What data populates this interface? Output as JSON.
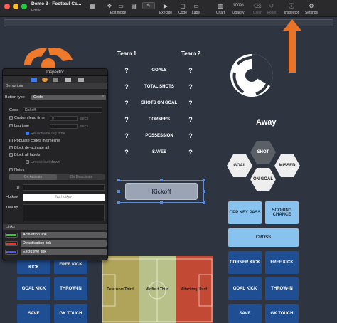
{
  "window": {
    "title": "Demo 3 - Football Co...",
    "subtitle": "Edited"
  },
  "toolbar": {
    "edit_mode_label": "Edit mode",
    "execute_label": "Execute",
    "code_label": "Code",
    "label_label": "Label",
    "chart_label": "Chart",
    "zoom_value": "100%",
    "opacity_label": "Opacity",
    "clear_label": "Clear",
    "reset_label": "Reset",
    "inspector_label": "Inspector",
    "settings_label": "Settings"
  },
  "scoreboard": {
    "team1": "Team 1",
    "team2": "Team 2",
    "placeholder": "?",
    "stats": [
      "GOALS",
      "TOTAL SHOTS",
      "SHOTS ON GOAL",
      "CORNERS",
      "POSSESSION",
      "SAVES"
    ]
  },
  "away": {
    "label": "Away"
  },
  "hex_buttons": {
    "shot": "SHOT",
    "goal": "GOAL",
    "missed": "MISSED",
    "on_goal": "ON GOAL"
  },
  "kickoff": {
    "label": "Kickoff"
  },
  "right_buttons": {
    "opp_key_pass": "OPP KEY PASS",
    "scoring_chance": "SCORING CHANCE",
    "cross": "CROSS",
    "corner_kick": "CORNER KICK",
    "free_kick": "FREE KICK",
    "goal_kick": "GOAL KICK",
    "throw_in": "THROW-IN",
    "save": "SAVE",
    "gk_touch": "GK TOUCH"
  },
  "left_buttons": {
    "kick": "KICK",
    "free_kick": "FREE KICK",
    "goal_kick": "GOAL KICK",
    "throw_in": "THROW-IN",
    "save": "SAVE",
    "gk_touch": "GK TOUCH"
  },
  "pitch": {
    "third1": "Defensive Third",
    "third2": "Midfield Third",
    "third3": "Attacking Third"
  },
  "inspector": {
    "title": "Inspector",
    "section_behaviour": "Behaviour",
    "button_type_label": "Button type",
    "button_type_value": "Code",
    "code_label": "Code",
    "code_value": "Kickoff",
    "custom_lead_time": "Custom lead time",
    "lead_value": "0",
    "secs": "secs",
    "lag_time": "Lag time",
    "lag_value": "1",
    "reactivate_lag": "Re-activate lag time",
    "populate_codes": "Populate codes in timeline",
    "block_deactivate": "Block de-activate all",
    "block_labels": "Block all labels",
    "unless_last": "Unless last down",
    "notes": "Notes",
    "on_activate": "On Activate",
    "on_deactivate": "On Deactivate",
    "id_label": "ID",
    "hotkey_label": "Hotkey",
    "hotkey_placeholder": "No Hotkey",
    "tooltip_label": "Tool tip",
    "section_links": "Links",
    "activation_link": "Activation link",
    "deactivation_link": "Deactivation link",
    "exclusive_link": "Exclusive link"
  },
  "colors": {
    "canvas": "#2e3440",
    "accent_orange": "#f07a2c",
    "light_button": "#87c3ee",
    "dark_button": "#1f4f92",
    "arrow": "#e8742a"
  }
}
